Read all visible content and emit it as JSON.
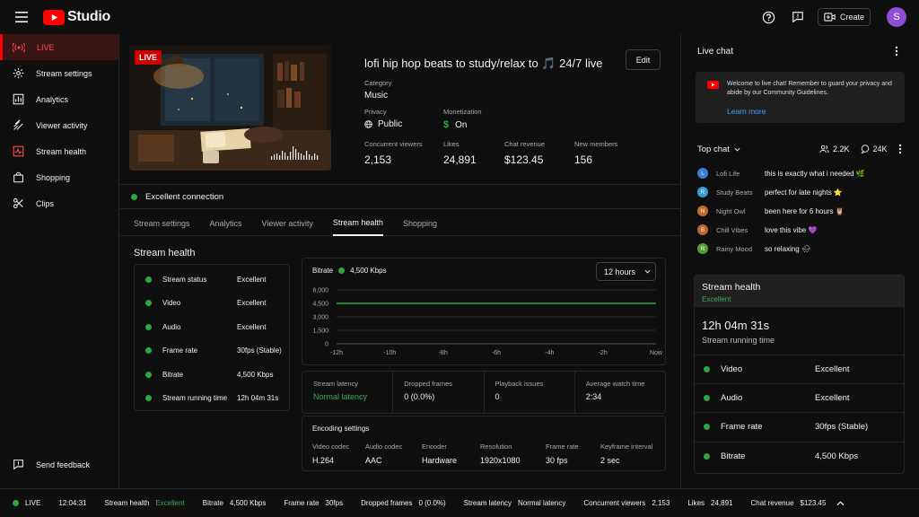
{
  "app": {
    "name": "Studio",
    "create_label": "Create",
    "avatar_letter": "S",
    "brand_color": "#ff0000"
  },
  "sidebar": {
    "items": [
      {
        "label": "LIVE",
        "icon": "live-icon",
        "active": true
      },
      {
        "label": "Stream settings",
        "icon": "gear-icon"
      },
      {
        "label": "Analytics",
        "icon": "analytics-icon"
      },
      {
        "label": "Viewer activity",
        "icon": "activity-icon"
      },
      {
        "label": "Stream health",
        "icon": "health-icon"
      },
      {
        "label": "Shopping",
        "icon": "shopping-icon"
      },
      {
        "label": "Clips",
        "icon": "scissors-icon"
      }
    ],
    "feedback_label": "Send feedback"
  },
  "stream": {
    "badge": "LIVE",
    "title": "lofi hip hop beats to study/relax to 🎵 24/7 live",
    "edit_label": "Edit",
    "category_label": "Category",
    "category": "Music",
    "privacy_label": "Privacy",
    "privacy": "Public",
    "monetization_label": "Monetization",
    "monetization": "On",
    "stats": [
      {
        "label": "Concurrent viewers",
        "value": "2,153"
      },
      {
        "label": "Likes",
        "value": "24,891"
      },
      {
        "label": "Chat revenue",
        "value": "$123.45"
      },
      {
        "label": "New members",
        "value": "156"
      }
    ]
  },
  "connection": "Excellent connection",
  "tabs": [
    "Stream settings",
    "Analytics",
    "Viewer activity",
    "Stream health",
    "Shopping"
  ],
  "health": {
    "title": "Stream health",
    "rows": [
      {
        "label": "Stream status",
        "value": "Excellent"
      },
      {
        "label": "Video",
        "value": "Excellent"
      },
      {
        "label": "Audio",
        "value": "Excellent"
      },
      {
        "label": "Frame rate",
        "value": "30fps (Stable)"
      },
      {
        "label": "Bitrate",
        "value": "4,500 Kbps"
      },
      {
        "label": "Stream running time",
        "value": "12h 04m 31s"
      }
    ],
    "bitrate_label": "Bitrate",
    "bitrate_value": "4,500 Kbps",
    "range": "12 hours",
    "metrics": [
      {
        "label": "Stream latency",
        "value": "Normal latency"
      },
      {
        "label": "Dropped frames",
        "value": "0 (0.0%)"
      },
      {
        "label": "Playback issues",
        "value": "0"
      },
      {
        "label": "Average watch time",
        "value": "2:34"
      }
    ],
    "encoding_title": "Encoding settings",
    "encoding": [
      {
        "label": "Video codec",
        "value": "H.264"
      },
      {
        "label": "Audio codec",
        "value": "AAC"
      },
      {
        "label": "Encoder",
        "value": "Hardware"
      },
      {
        "label": "Resolution",
        "value": "1920x1080"
      },
      {
        "label": "Frame rate",
        "value": "30 fps"
      },
      {
        "label": "Keyframe interval",
        "value": "2 sec"
      }
    ]
  },
  "chart_data": {
    "type": "line",
    "x": [
      "-12h",
      "-10h",
      "-8h",
      "-6h",
      "-4h",
      "-2h",
      "Now"
    ],
    "series": [
      {
        "values": [
          4500,
          4500,
          4500,
          4500,
          4500,
          4500,
          4500
        ]
      }
    ],
    "yticks": [
      "6,000",
      "4,500",
      "3,000",
      "1,500",
      "0"
    ],
    "ylim": [
      0,
      6000
    ],
    "color": "#2ba640"
  },
  "chat": {
    "title": "Live chat",
    "welcome": "Welcome to live chat! Remember to guard your privacy and abide by our Community Guidelines.",
    "learn_more": "Learn more",
    "top_chat": "Top chat",
    "viewers": "2.2K",
    "messages_count": "24K",
    "messages": [
      {
        "initial": "L",
        "name": "Lofi Life",
        "text": "this is exactly what i needed 🌿",
        "color": "#3d7bd9"
      },
      {
        "initial": "R",
        "name": "Study Beats",
        "text": "perfect for late nights ⭐",
        "color": "#3a9ad9"
      },
      {
        "initial": "N",
        "name": "Night Owl",
        "text": "been here for 6 hours 🦉",
        "color": "#c56a2b"
      },
      {
        "initial": "B",
        "name": "Chill Vibes",
        "text": "love this vibe 💜",
        "color": "#b5652e"
      },
      {
        "initial": "R",
        "name": "Rainy Mood",
        "text": "so relaxing 🌧",
        "color": "#5a9a3a"
      }
    ]
  },
  "health_card": {
    "title": "Stream health",
    "status": "Excellent",
    "time": "12h 04m 31s",
    "time_label": "Stream running time",
    "rows": [
      {
        "label": "Video",
        "value": "Excellent"
      },
      {
        "label": "Audio",
        "value": "Excellent"
      },
      {
        "label": "Frame rate",
        "value": "30fps (Stable)"
      },
      {
        "label": "Bitrate",
        "value": "4,500 Kbps"
      }
    ]
  },
  "footer": {
    "live": "LIVE",
    "clock": "12:04:31",
    "items": [
      {
        "label": "Stream health",
        "value": "Excellent"
      },
      {
        "label": "Bitrate",
        "value": "4,500 Kbps"
      },
      {
        "label": "Frame rate",
        "value": "30fps"
      },
      {
        "label": "Dropped frames",
        "value": "0 (0.0%)"
      },
      {
        "label": "Stream latency",
        "value": "Normal latency"
      },
      {
        "label": "Concurrent viewers",
        "value": "2,153"
      },
      {
        "label": "Likes",
        "value": "24,891"
      },
      {
        "label": "Chat revenue",
        "value": "$123.45"
      }
    ]
  }
}
